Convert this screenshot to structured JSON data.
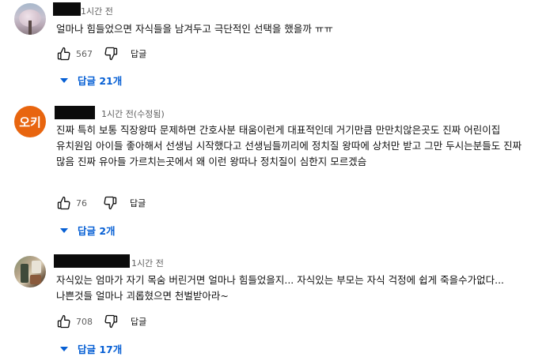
{
  "comments": [
    {
      "avatar": "cherry-blossom-photo",
      "time": "1시간 전",
      "text": "얼마나 힘들었으면 자식들을 남겨두고 극단적인 선택을 했을까 ㅠㅠ",
      "likes": "567",
      "reply_label": "답글",
      "replies_label": "답글 21개"
    },
    {
      "avatar_text": "오키",
      "avatar_color": "#e8650f",
      "time": "1시간 전(수정됨)",
      "text": "진짜 특히 보통 직장왕따 문제하면 간호사분 태움이런게 대표적인데 거기만큼 만만치않은곳도 진짜 어린이집 유치원임 아이들 좋아해서 선생님 시작했다고 선생님들끼리에 정치질 왕따에 상처만 받고 그만 두시는분들도 진짜 많음 진짜 유아들 가르치는곳에서 왜 이런 왕따나 정치질이 심한지 모르겠슴",
      "likes": "76",
      "reply_label": "답글",
      "replies_label": "답글 2개"
    },
    {
      "avatar": "interior-photo",
      "time": "1시간 전",
      "text": "자식있는 엄마가 자기 목숨 버린거면 얼마나 힘들었을지... 자식있는 부모는 자식 걱정에 쉽게 죽을수가없다... 나쁜것들 얼마나 괴롭혔으면 천벌받아라~",
      "likes": "708",
      "reply_label": "답글",
      "replies_label": "답글 17개"
    }
  ],
  "colors": {
    "link_blue": "#065fd4",
    "meta_gray": "#606060",
    "text": "#0f0f0f"
  },
  "icons": [
    "thumbs-up-icon",
    "thumbs-down-icon",
    "caret-down-icon"
  ]
}
